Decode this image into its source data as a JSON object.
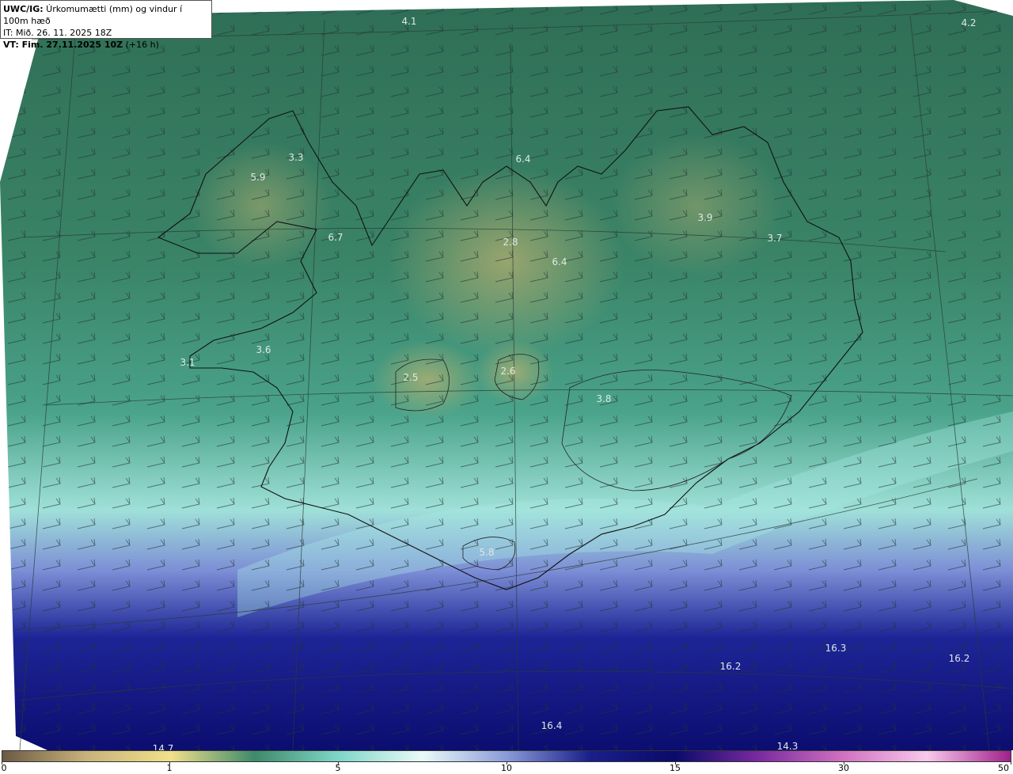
{
  "info": {
    "line1_bold": "UWC/IG:",
    "line1_text": " Úrkomumætti (mm) og vindur í 100m hæð",
    "line2": "IT: Mið. 26. 11. 2025 18Z",
    "line3_bold": "VT: Fim. 27.11.2025 10Z",
    "line3_text": " (+16 h)"
  },
  "map_values": [
    "4.1",
    "4.2",
    "3.3",
    "5.9",
    "6.4",
    "6.7",
    "2.8",
    "6.4",
    "3.9",
    "3.7",
    "3.6",
    "3.1",
    "2.5",
    "2.6",
    "3.8",
    "5.8",
    "16.3",
    "16.2",
    "16.2",
    "16.4",
    "14.7",
    "14.3"
  ],
  "colorbar": {
    "ticks": [
      "0",
      "1",
      "5",
      "10",
      "15",
      "30",
      "50"
    ],
    "colors": [
      "#6b5a44",
      "#c8b27a",
      "#f0e08a",
      "#3e8a6a",
      "#7fd6c8",
      "#eafaf8",
      "#8a9ad8",
      "#1a1f8a",
      "#0a0a6a",
      "#7a2aa0",
      "#d070c0",
      "#f8c8ec",
      "#a0208a"
    ]
  }
}
